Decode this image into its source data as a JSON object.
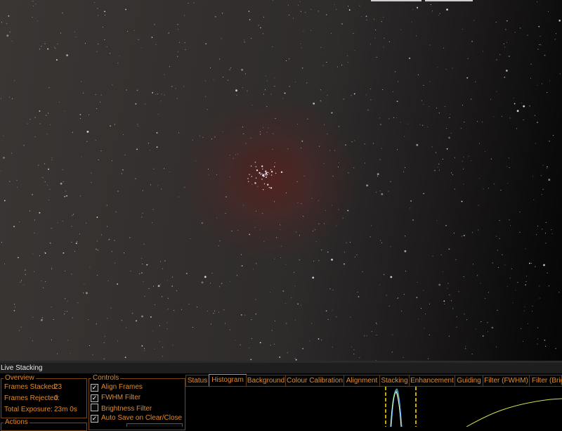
{
  "panel": {
    "title": "Live Stacking",
    "overview": {
      "legend": "Overview",
      "frames_stacked_label": "Frames Stacked:",
      "frames_stacked_value": "23",
      "frames_rejected_label": "Frames Rejected:",
      "frames_rejected_value": "0",
      "total_exposure_label": "Total Exposure:",
      "total_exposure_value": "23m 0s"
    },
    "actions": {
      "legend": "Actions"
    },
    "controls": {
      "legend": "Controls",
      "items": [
        {
          "label": "Align Frames",
          "checked": true
        },
        {
          "label": "FWHM Filter",
          "checked": true
        },
        {
          "label": "Brightness Filter",
          "checked": false
        },
        {
          "label": "Auto Save on Clear/Close",
          "checked": true
        }
      ]
    },
    "tabs": [
      {
        "label": "Status",
        "active": false
      },
      {
        "label": "Histogram",
        "active": true
      },
      {
        "label": "Background",
        "active": false
      },
      {
        "label": "Colour Calibration",
        "active": false
      },
      {
        "label": "Alignment",
        "active": false
      },
      {
        "label": "Stacking",
        "active": false
      },
      {
        "label": "Enhancement",
        "active": false
      },
      {
        "label": "Guiding",
        "active": false
      },
      {
        "label": "Filter (FWHM)",
        "active": false
      },
      {
        "label": "Filter (Brigh",
        "active": false
      }
    ],
    "histogram": {
      "marker_color": "#ffe600",
      "curve_color": "#d8e04a",
      "channel_colors": [
        "#ff4a4a",
        "#3ad24a",
        "#4aa8ff",
        "#ffffff"
      ]
    }
  },
  "colors": {
    "accent": "#e08a2a",
    "panel_bg": "#000000",
    "title_bar_bg": "#1e1e1e"
  }
}
